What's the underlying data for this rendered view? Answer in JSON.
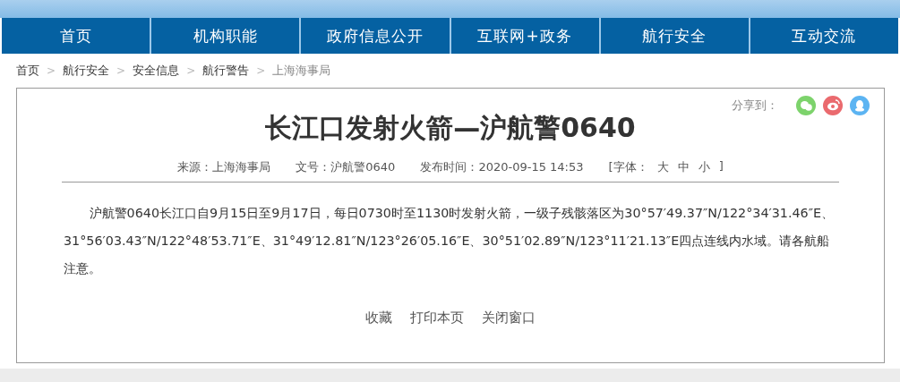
{
  "nav": [
    {
      "label": "首页"
    },
    {
      "label": "机构职能"
    },
    {
      "label": "政府信息公开"
    },
    {
      "label": "互联网+政务"
    },
    {
      "label": "航行安全"
    },
    {
      "label": "互动交流"
    }
  ],
  "breadcrumb": [
    {
      "label": "首页",
      "current": false
    },
    {
      "label": "航行安全",
      "current": false
    },
    {
      "label": "安全信息",
      "current": false
    },
    {
      "label": "航行警告",
      "current": false
    },
    {
      "label": "上海海事局",
      "current": true
    }
  ],
  "breadcrumb_separator": ">",
  "share": {
    "label": "分享到：",
    "services": [
      {
        "kind": "chat",
        "color": "#7dd36c"
      },
      {
        "kind": "eye",
        "color": "#ea6a6e"
      },
      {
        "kind": "figure",
        "color": "#5cb4f2"
      }
    ]
  },
  "article": {
    "title": "长江口发射火箭—沪航警0640",
    "meta": [
      {
        "kind": "text",
        "text": "来源：上海海事局"
      },
      {
        "kind": "text",
        "text": "文号：沪航警0640"
      },
      {
        "kind": "text",
        "text": "发布时间：2020-09-15 14:53"
      }
    ],
    "font_size": {
      "open": "[字体：",
      "options": [
        "大",
        "中",
        "小"
      ],
      "close": "]"
    },
    "body": "沪航警0640长江口自9月15日至9月17日，每日0730时至1130时发射火箭，一级子残骸落区为30°57′49.37″N/122°34′31.46″E、31°56′03.43″N/122°48′53.71″E、31°49′12.81″N/123°26′05.16″E、30°51′02.89″N/123°11′21.13″E四点连线内水域。请各航船注意。",
    "actions": [
      "收藏",
      "打印本页",
      "关闭窗口"
    ]
  }
}
